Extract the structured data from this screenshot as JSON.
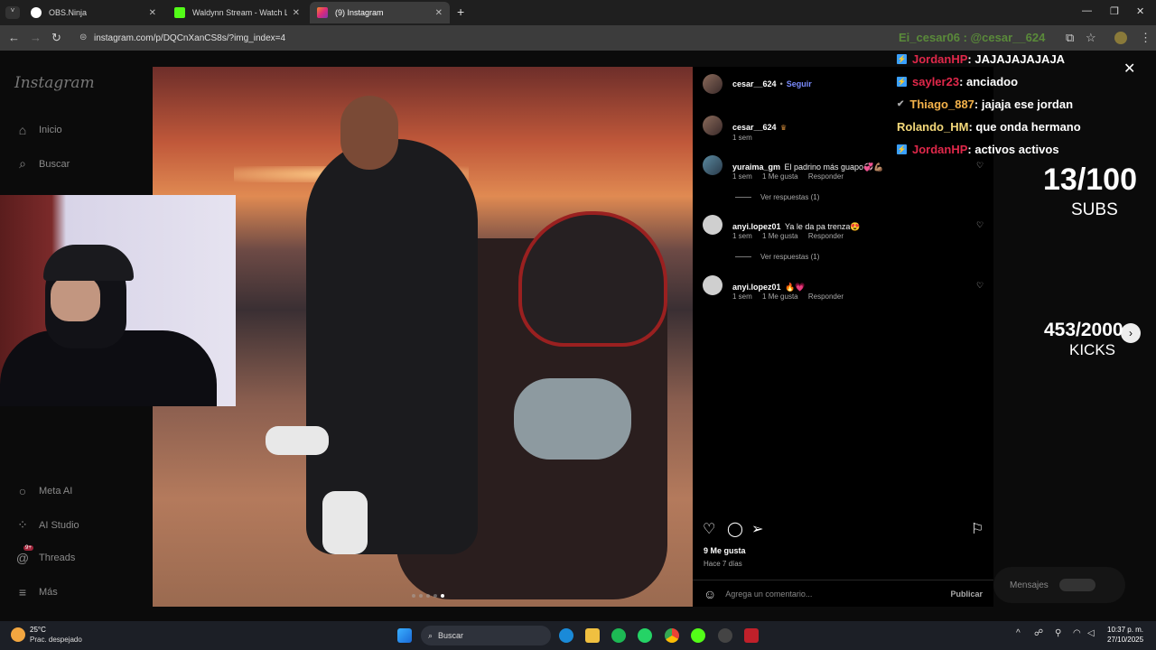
{
  "tabs": [
    {
      "title": "OBS.Ninja"
    },
    {
      "title": "Waldynn Stream - Watch Live o"
    },
    {
      "title": "(9) Instagram"
    }
  ],
  "address": {
    "url": "instagram.com/p/DQCnXanCS8s/?img_index=4"
  },
  "overlay_handle": "Ei_cesar06 : @cesar__624",
  "sidebar": {
    "logo": "Instagram",
    "items": [
      {
        "label": "Inicio",
        "icon": "home-icon"
      },
      {
        "label": "Buscar",
        "icon": "search-icon"
      },
      {
        "label": "Meta AI",
        "icon": "meta-ai-icon"
      },
      {
        "label": "AI Studio",
        "icon": "ai-studio-icon"
      },
      {
        "label": "Threads",
        "icon": "threads-icon",
        "badge": "9+"
      },
      {
        "label": "Más",
        "icon": "menu-icon"
      }
    ]
  },
  "post": {
    "author": "cesar__624",
    "follow": "Seguir",
    "caption_time": "1 sem",
    "comments": [
      {
        "user": "yuraima_gm",
        "text": "El padrino más guapo💞💪🏽",
        "time": "1 sem",
        "likes": "1 Me gusta",
        "reply": "Responder",
        "view_replies": "Ver respuestas (1)"
      },
      {
        "user": "anyi.lopez01",
        "text": "Ya le da pa trenza😍",
        "time": "1 sem",
        "likes": "1 Me gusta",
        "reply": "Responder",
        "view_replies": "Ver respuestas (1)"
      },
      {
        "user": "anyi.lopez01",
        "text": "🔥💗",
        "time": "1 sem",
        "likes": "1 Me gusta",
        "reply": "Responder"
      }
    ],
    "likes": "9 Me gusta",
    "posted": "Hace 7 días",
    "add_comment_placeholder": "Agrega un comentario...",
    "publish": "Publicar"
  },
  "chat": [
    {
      "user": "JordanHP",
      "msg": " : JAJAJAJAJAJA",
      "color": "#e0284a"
    },
    {
      "user": "sayler23",
      "msg": " : anciadoo",
      "color": "#e0284a"
    },
    {
      "user": "Thiago_887",
      "msg": " : jajaja ese jordan",
      "color": "#f4b24a"
    },
    {
      "user": "Rolando_HM",
      "msg": " : que onda hermano",
      "color": "#f4d97a"
    },
    {
      "user": "JordanHP",
      "msg": " : activos activos",
      "color": "#e0284a"
    }
  ],
  "stats": {
    "subs_count": "13/100",
    "subs_label": "SUBS",
    "kicks_count": "453/2000",
    "kicks_label": "KICKS"
  },
  "messages_button": "Mensajes",
  "taskbar": {
    "weather_temp": "25°C",
    "weather_desc": "Prac. despejado",
    "search": "Buscar",
    "time": "10:37 p. m.",
    "date": "27/10/2025"
  }
}
